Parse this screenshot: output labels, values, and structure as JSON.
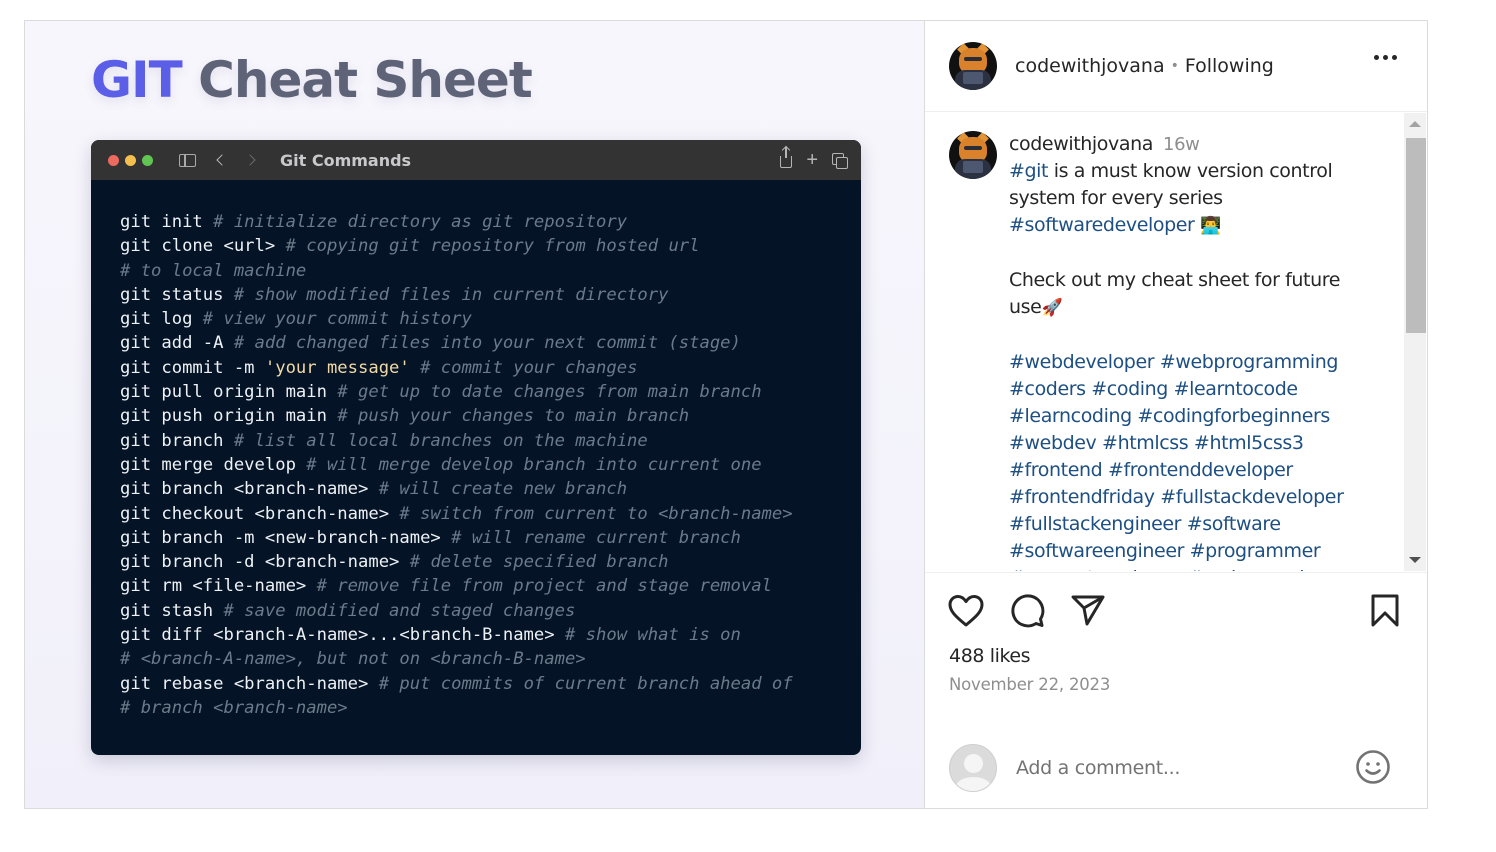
{
  "media": {
    "title_accent": "GIT",
    "title_rest": " Cheat Sheet",
    "window": {
      "title": "Git Commands",
      "icons": [
        "close-dot",
        "minimize-dot",
        "zoom-dot",
        "sidebar-icon",
        "back-icon",
        "forward-icon",
        "share-icon",
        "plus-icon",
        "tabs-icon"
      ]
    },
    "code_lines": [
      {
        "cmd": "git init ",
        "cmt": "# initialize directory as git repository"
      },
      {
        "cmd": "git clone <url> ",
        "cmt": "# copying git repository from hosted url"
      },
      {
        "cmd": "",
        "cmt": "# to local machine"
      },
      {
        "cmd": "git status ",
        "cmt": "# show modified files in current directory"
      },
      {
        "cmd": "git log ",
        "cmt": "# view your commit history"
      },
      {
        "cmd": "git add -A ",
        "cmt": "# add changed files into your next commit (stage)"
      },
      {
        "cmd": "git commit -m ",
        "str": "'your message'",
        "cmd2": " ",
        "cmt": "# commit your changes"
      },
      {
        "cmd": "git pull origin main ",
        "cmt": "# get up to date changes from main branch"
      },
      {
        "cmd": "git push origin main ",
        "cmt": "# push your changes to main branch"
      },
      {
        "cmd": "git branch ",
        "cmt": "# list all local branches on the machine"
      },
      {
        "cmd": "git merge develop ",
        "cmt": "# will merge develop branch into current one"
      },
      {
        "cmd": "git branch <branch-name> ",
        "cmt": "# will create new branch"
      },
      {
        "cmd": "git checkout <branch-name> ",
        "cmt": "# switch from current to <branch-name>"
      },
      {
        "cmd": "git branch -m <new-branch-name> ",
        "cmt": "# will rename current branch"
      },
      {
        "cmd": "git branch -d <branch-name> ",
        "cmt": "# delete specified branch"
      },
      {
        "cmd": "git rm <file-name> ",
        "cmt": "# remove file from project and stage removal"
      },
      {
        "cmd": "git stash ",
        "cmt": "# save modified and staged changes"
      },
      {
        "cmd": "git diff <branch-A-name>...<branch-B-name> ",
        "cmt": "# show what is on"
      },
      {
        "cmd": "",
        "cmt": "# <branch-A-name>, but not on <branch-B-name>"
      },
      {
        "cmd": "git rebase <branch-name> ",
        "cmt": "# put commits of current branch ahead of"
      },
      {
        "cmd": "",
        "cmt": "# branch <branch-name>"
      }
    ]
  },
  "header": {
    "username": "codewithjovana",
    "separator": "•",
    "follow_status": "Following",
    "more_icon": "more-horizontal-icon"
  },
  "caption": {
    "username": "codewithjovana",
    "time": "16w",
    "line1_tag": "#git",
    "line1_text": " is a must know version control system for every series",
    "line2_tag": "#softwaredeveloper",
    "line2_emoji": "👨‍💻",
    "line3_text": "Check out my cheat sheet for future use",
    "line3_emoji": "🚀",
    "hashtags": [
      "#webdeveloper #webprogramming",
      "#coders #coding #learntocode",
      "#learncoding #codingforbeginners",
      "#webdev #htmlcss #html5css3",
      "#frontend #frontenddeveloper",
      "#frontendfriday #fullstackdeveloper",
      "#fullstackengineer #software",
      "#softwareengineer #programmer",
      "#computerscience #codemeaning"
    ]
  },
  "actions": {
    "icons": [
      "heart-icon",
      "comment-icon",
      "share-icon",
      "bookmark-icon"
    ],
    "likes": "488 likes",
    "date": "November 22, 2023"
  },
  "comment": {
    "placeholder": "Add a comment...",
    "emoji_icon": "smiley-icon"
  }
}
